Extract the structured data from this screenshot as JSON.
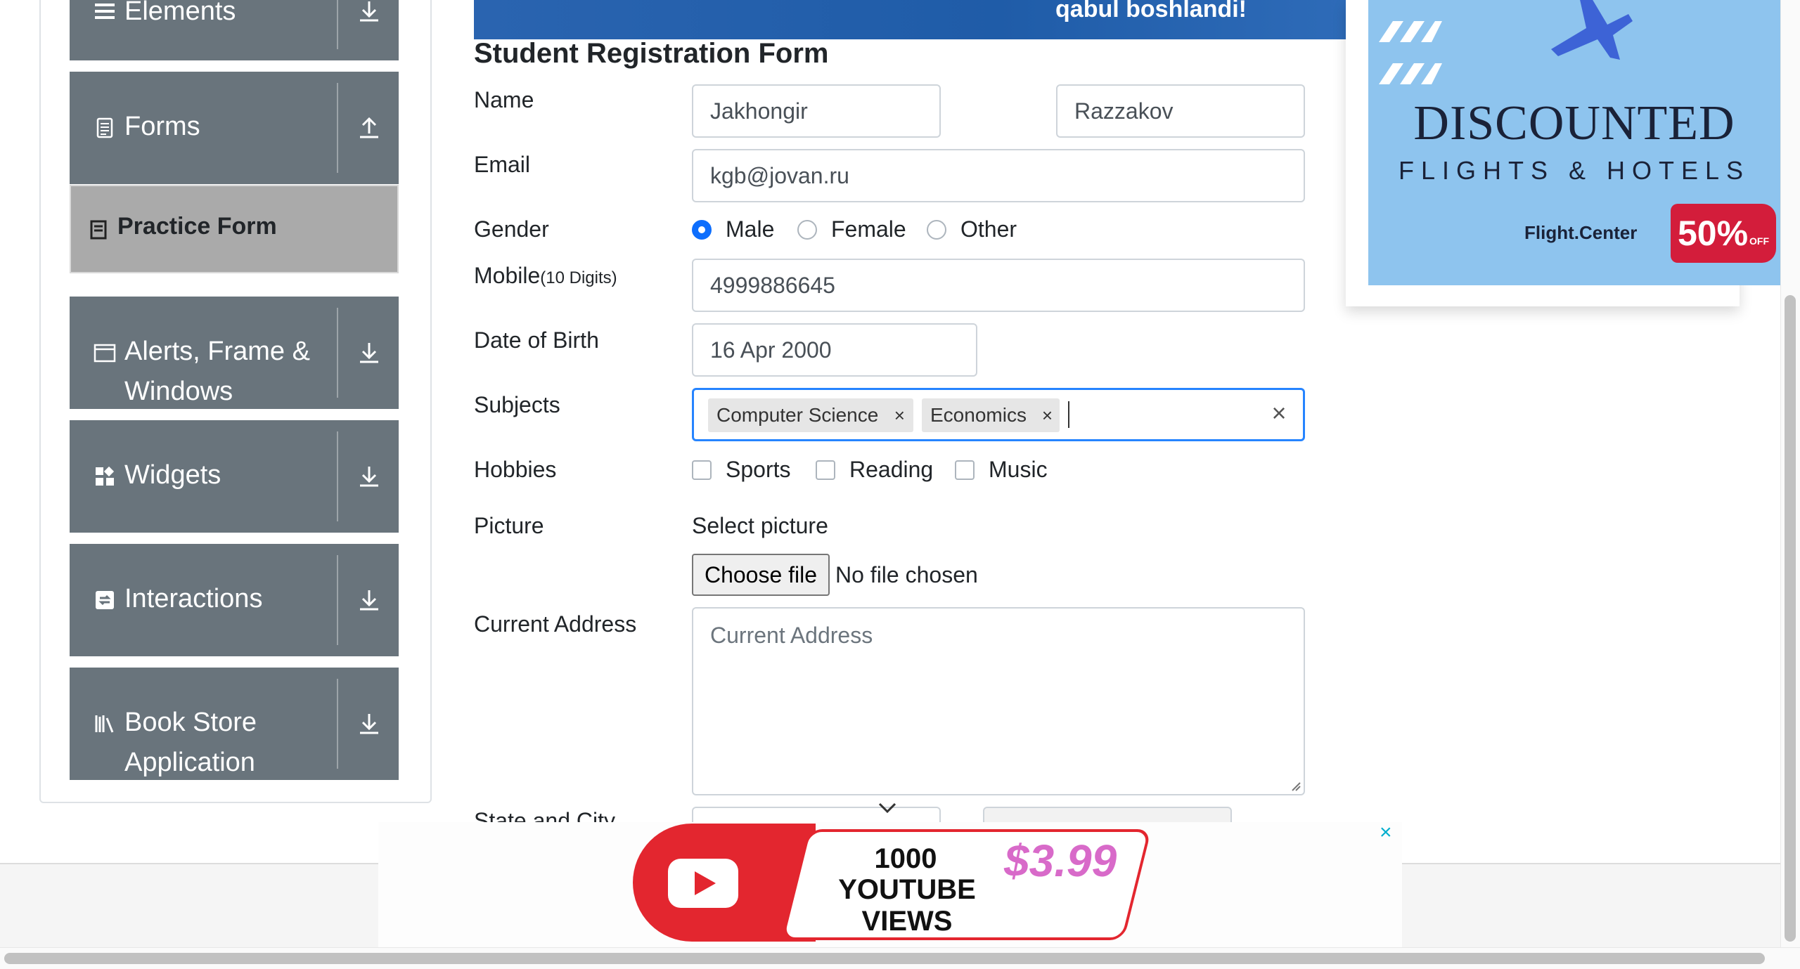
{
  "sidebar": {
    "groups": [
      {
        "label": "Elements",
        "icon": "list-icon",
        "arrow": "download-icon"
      },
      {
        "label": "Forms",
        "icon": "document-icon",
        "arrow": "upload-icon"
      },
      {
        "label": "Alerts, Frame & Windows",
        "icon": "window-icon",
        "arrow": "download-icon"
      },
      {
        "label": "Widgets",
        "icon": "widgets-icon",
        "arrow": "download-icon"
      },
      {
        "label": "Interactions",
        "icon": "interactions-icon",
        "arrow": "download-icon"
      },
      {
        "label": "Book Store Application",
        "icon": "books-icon",
        "arrow": "download-icon"
      }
    ],
    "active_item": {
      "label": "Practice Form",
      "icon": "form-icon"
    }
  },
  "top_banner": {
    "text": "qabul boshlandi!"
  },
  "form": {
    "title": "Student Registration Form",
    "name": {
      "label": "Name",
      "first": "Jakhongir",
      "last": "Razzakov"
    },
    "email": {
      "label": "Email",
      "value": "kgb@jovan.ru"
    },
    "gender": {
      "label": "Gender",
      "options": [
        "Male",
        "Female",
        "Other"
      ],
      "selected": "Male"
    },
    "mobile": {
      "label": "Mobile",
      "hint": "(10 Digits)",
      "value": "4999886645"
    },
    "dob": {
      "label": "Date of Birth",
      "value": "16 Apr 2000"
    },
    "subjects": {
      "label": "Subjects",
      "chips": [
        "Computer Science",
        "Economics"
      ],
      "chip_remove": "×",
      "clear": "×"
    },
    "hobbies": {
      "label": "Hobbies",
      "options": [
        "Sports",
        "Reading",
        "Music"
      ]
    },
    "picture": {
      "label": "Picture",
      "select_text": "Select picture",
      "button": "Choose file",
      "status": "No file chosen"
    },
    "address": {
      "label": "Current Address",
      "placeholder": "Current Address"
    },
    "state_city": {
      "label": "State and City"
    }
  },
  "right_ad": {
    "headline": "DISCOUNTED",
    "subline": "FLIGHTS & HOTELS",
    "brand": "Flight.Center",
    "discount": "50%",
    "discount_sub": "OFF"
  },
  "bottom_ad": {
    "line1": "1000",
    "line2": "YOUTUBE VIEWS",
    "price": "$3.99",
    "close": "×"
  },
  "colors": {
    "sidebar": "#69747c",
    "active": "#aaaaaa",
    "accent": "#0d6efd",
    "focus": "#2684ff",
    "ad_red": "#e3262f"
  }
}
